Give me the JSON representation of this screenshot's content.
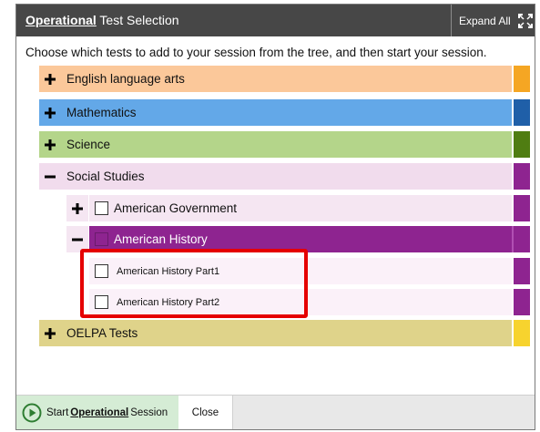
{
  "dialog": {
    "title_bold": "Operational",
    "title_rest": " Test Selection",
    "expand_all": "Expand All"
  },
  "instructions": "Choose which tests to add to your session from the tree, and then start your session.",
  "tree": {
    "ela": {
      "label": "English language arts",
      "color": "#fbc89a",
      "endcap": "#f5a623"
    },
    "math": {
      "label": "Mathematics",
      "color": "#63a8e8",
      "endcap": "#1f5fa8"
    },
    "science": {
      "label": "Science",
      "color": "#b4d58a",
      "endcap": "#4f7d12"
    },
    "social_studies": {
      "label": "Social Studies",
      "color": "#f1dced",
      "endcap": "#8e2490",
      "children": [
        {
          "label": "American Government"
        },
        {
          "label": "American History",
          "children": [
            {
              "label": "American History Part1"
            },
            {
              "label": "American History Part2"
            }
          ]
        }
      ]
    },
    "oelpa": {
      "label": "OELPA Tests",
      "color": "#dfd38a",
      "endcap": "#f7d32e"
    }
  },
  "footer": {
    "start_prefix": "Start ",
    "start_bold": "Operational",
    "start_suffix": " Session",
    "close": "Close"
  },
  "icons": [
    "expand-icon",
    "plus-icon",
    "minus-icon",
    "play-icon"
  ]
}
